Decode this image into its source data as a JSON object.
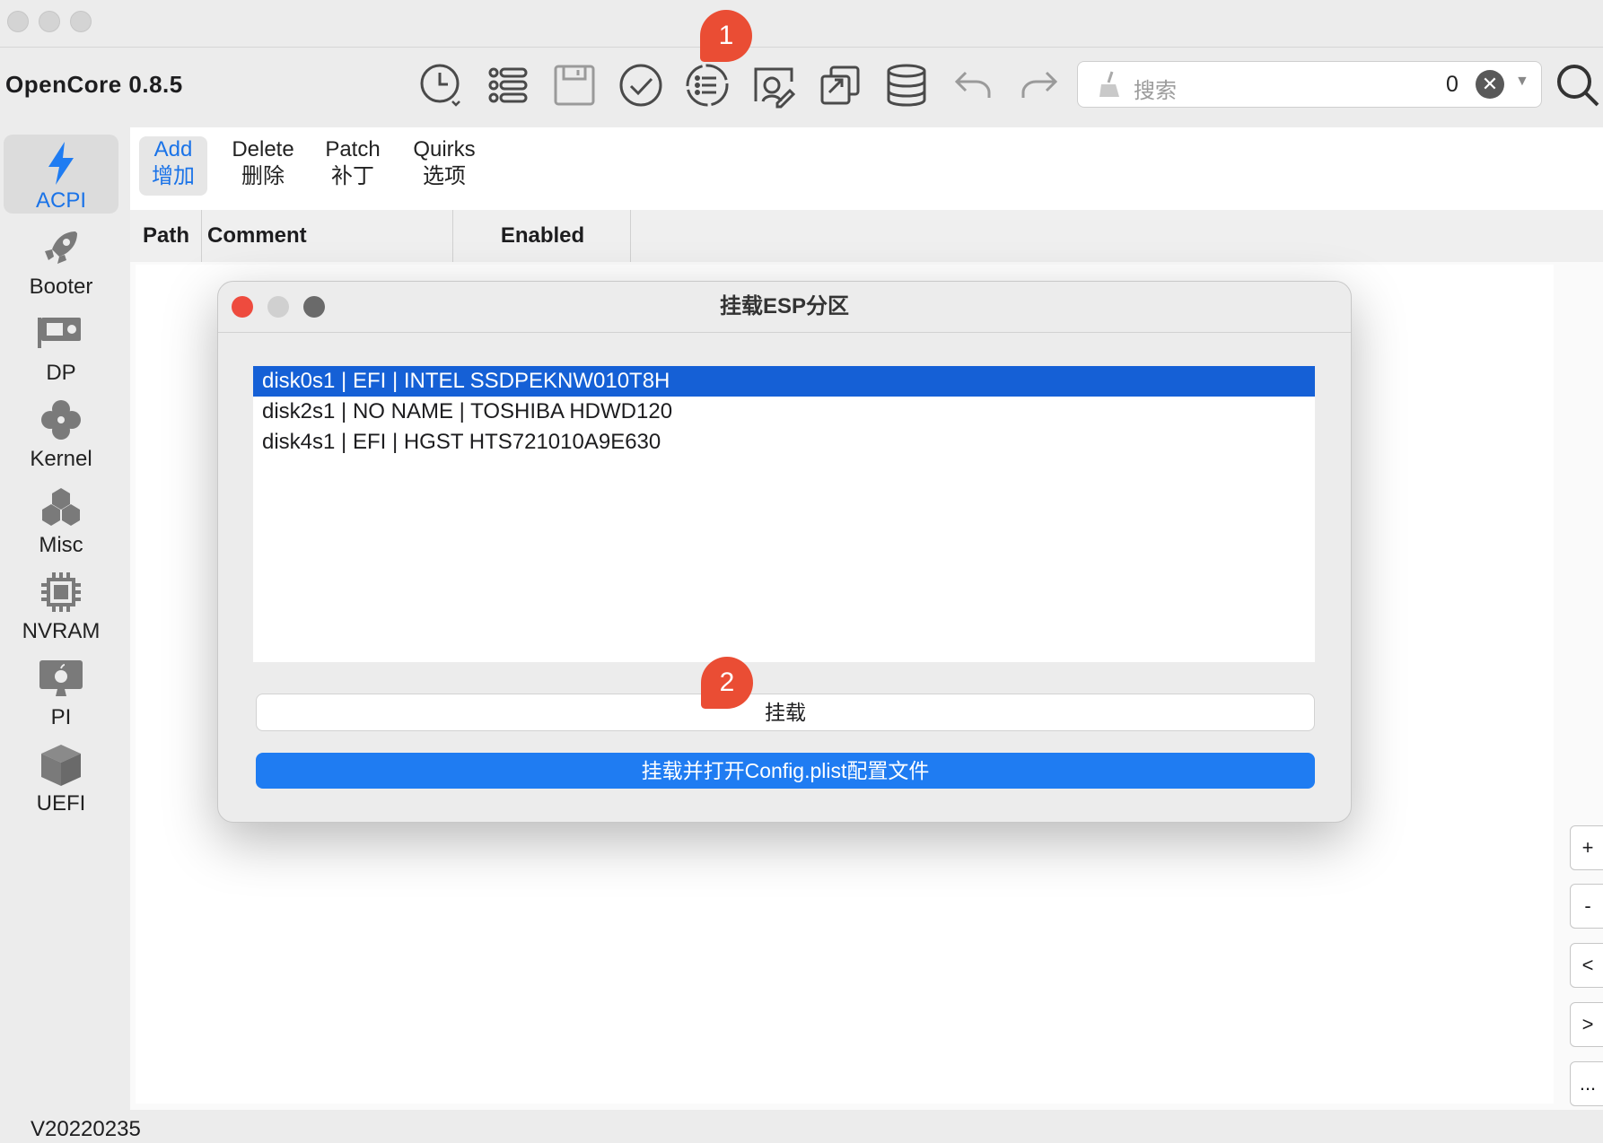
{
  "window": {
    "title": "OpenCore 0.8.5"
  },
  "toolbar": {
    "icons": [
      "history-icon",
      "list-icon",
      "save-icon",
      "check-icon",
      "list-circle-icon",
      "mount-esp-icon",
      "share-icon",
      "database-icon",
      "undo-icon",
      "redo-icon"
    ],
    "badge1": "1",
    "search": {
      "placeholder": "搜索",
      "count": "0",
      "clear_glyph": "✕"
    },
    "search_icon": "magnifier-icon"
  },
  "sidebar": {
    "items": [
      {
        "label": "ACPI",
        "icon": "bolt-icon",
        "active": true
      },
      {
        "label": "Booter",
        "icon": "rocket-icon"
      },
      {
        "label": "DP",
        "icon": "gpu-icon"
      },
      {
        "label": "Kernel",
        "icon": "kernel-icon"
      },
      {
        "label": "Misc",
        "icon": "cubes-icon"
      },
      {
        "label": "NVRAM",
        "icon": "chip-icon"
      },
      {
        "label": "PI",
        "icon": "apple-monitor-icon"
      },
      {
        "label": "UEFI",
        "icon": "box-icon"
      }
    ]
  },
  "tabs": [
    {
      "en": "Add",
      "zh": "增加",
      "active": true
    },
    {
      "en": "Delete",
      "zh": "删除"
    },
    {
      "en": "Patch",
      "zh": "补丁"
    },
    {
      "en": "Quirks",
      "zh": "选项"
    }
  ],
  "columns": [
    "Path",
    "Comment",
    "Enabled"
  ],
  "right_buttons": [
    "+",
    "-",
    "<",
    ">",
    "..."
  ],
  "status": {
    "version": "V20220235"
  },
  "dialog": {
    "title": "挂载ESP分区",
    "rows": [
      "disk0s1 | EFI | INTEL SSDPEKNW010T8H",
      "disk2s1 | NO NAME | TOSHIBA HDWD120",
      "disk4s1 | EFI | HGST HTS721010A9E630"
    ],
    "selected_index": 0,
    "badge2": "2",
    "mount_label": "挂载",
    "mount_open_label": "挂载并打开Config.plist配置文件"
  },
  "colors": {
    "accent": "#1f7cf2",
    "selection": "#1560d6",
    "badge": "#ea4d34",
    "close": "#ee4b3e"
  }
}
